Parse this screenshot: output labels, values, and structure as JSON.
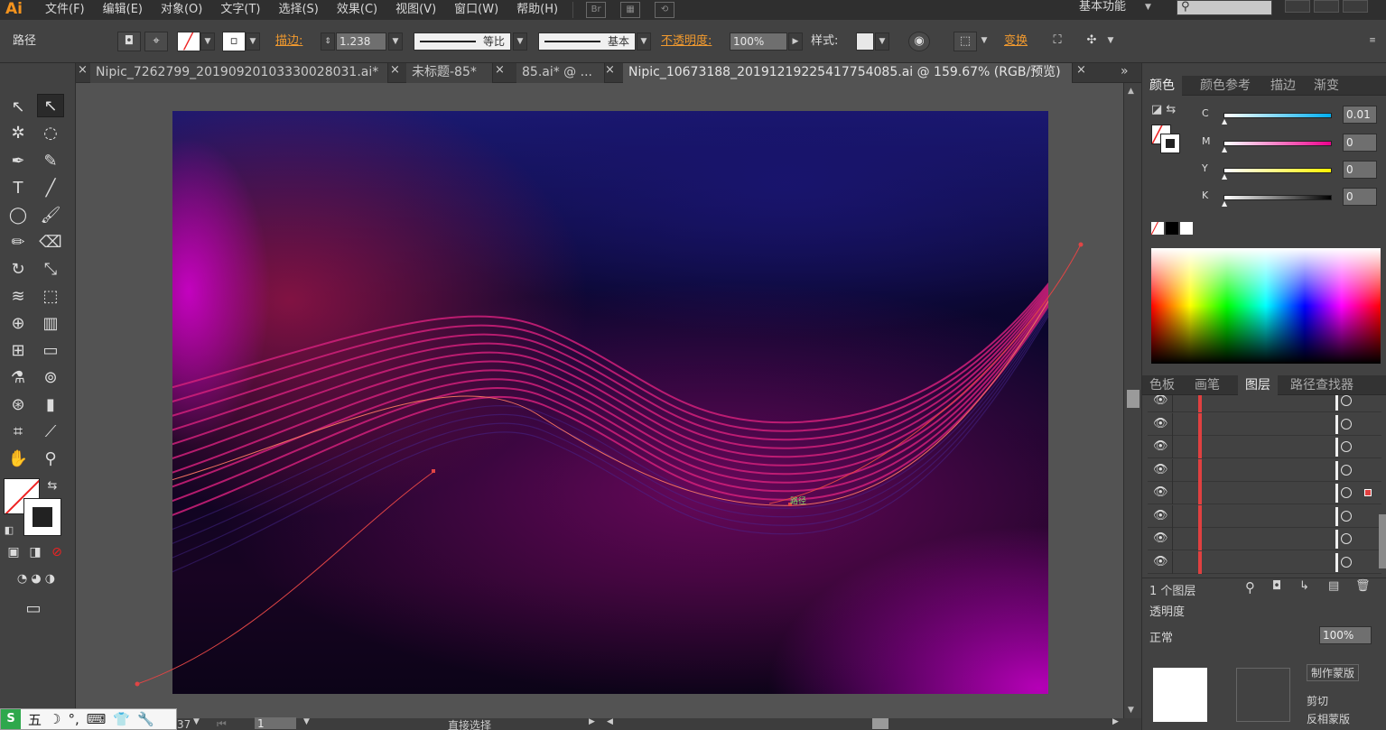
{
  "app": {
    "logo": "Ai"
  },
  "menubar": {
    "items": [
      "文件(F)",
      "编辑(E)",
      "对象(O)",
      "文字(T)",
      "选择(S)",
      "效果(C)",
      "视图(V)",
      "窗口(W)",
      "帮助(H)"
    ],
    "bridge_label": "Br",
    "workspace": "基本功能"
  },
  "controlbar": {
    "selection_type": "路径",
    "stroke_label": "描边:",
    "stroke_weight": "1.238",
    "stroke_profile": "等比",
    "brush": "基本",
    "opacity_label": "不透明度:",
    "opacity_value": "100%",
    "style_label": "样式:",
    "transform_label": "变换"
  },
  "tabs": [
    {
      "label": "Nipic_7262799_20190920103330028031.ai*"
    },
    {
      "label": "未标题-85*"
    },
    {
      "label": "85.ai* @ ..."
    },
    {
      "label": "Nipic_10673188_20191219225417754085.ai @ 159.67% (RGB/预览)"
    }
  ],
  "canvas": {
    "anchor_label": "路径"
  },
  "color_panel": {
    "tabs": [
      "颜色",
      "颜色参考",
      "描边",
      "渐变"
    ],
    "c": "0.01",
    "m": "0",
    "y": "0",
    "k": "0",
    "labels": [
      "C",
      "M",
      "Y",
      "K"
    ]
  },
  "layers_panel": {
    "tabs": [
      "色板",
      "画笔",
      "图层",
      "路径查找器"
    ],
    "footer_text": "1 个图层",
    "row_count": 8,
    "selected_row": 4
  },
  "transparency_panel": {
    "title": "透明度",
    "mode": "正常",
    "opacity": "100%",
    "btn_label": "制作蒙版",
    "clip_label": "剪切",
    "invert_label": "反相蒙版"
  },
  "statusbar": {
    "zoom": "37",
    "page": "1",
    "tool": "直接选择"
  },
  "ime": {
    "logo": "S",
    "items": [
      "五",
      "☽",
      "°,",
      "⌨",
      "👕",
      "🔧"
    ]
  },
  "colors": {
    "accent_orange": "#f29a2e",
    "path_red": "#e04545",
    "wave_magenta": "#d0207a"
  }
}
